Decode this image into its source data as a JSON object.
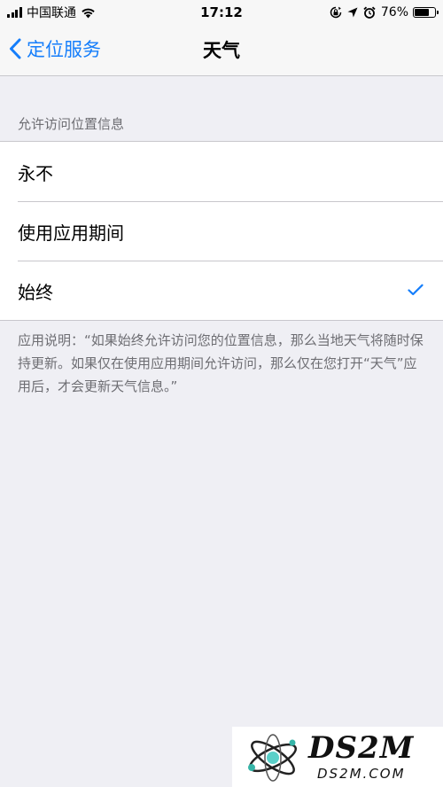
{
  "status_bar": {
    "carrier": "中国联通",
    "time": "17:12",
    "battery_percent": "76%",
    "battery_level": 0.76,
    "icons": [
      "signal-icon",
      "wifi-icon",
      "rotation-lock-icon",
      "location-arrow-icon",
      "alarm-icon",
      "battery-icon"
    ]
  },
  "nav": {
    "back_label": "定位服务",
    "title": "天气"
  },
  "section": {
    "header": "允许访问位置信息",
    "options": [
      {
        "label": "永不",
        "selected": false
      },
      {
        "label": "使用应用期间",
        "selected": false
      },
      {
        "label": "始终",
        "selected": true
      }
    ],
    "footer": "应用说明：“如果始终允许访问您的位置信息，那么当地天气将随时保持更新。如果仅在使用应用期间允许访问，那么仅在您打开“天气”应用后，才会更新天气信息。”"
  },
  "colors": {
    "accent": "#157efb",
    "background": "#efeff4",
    "secondary_text": "#6d6d72"
  },
  "watermark": {
    "title": "DS2M",
    "url": "DS2M.COM"
  }
}
